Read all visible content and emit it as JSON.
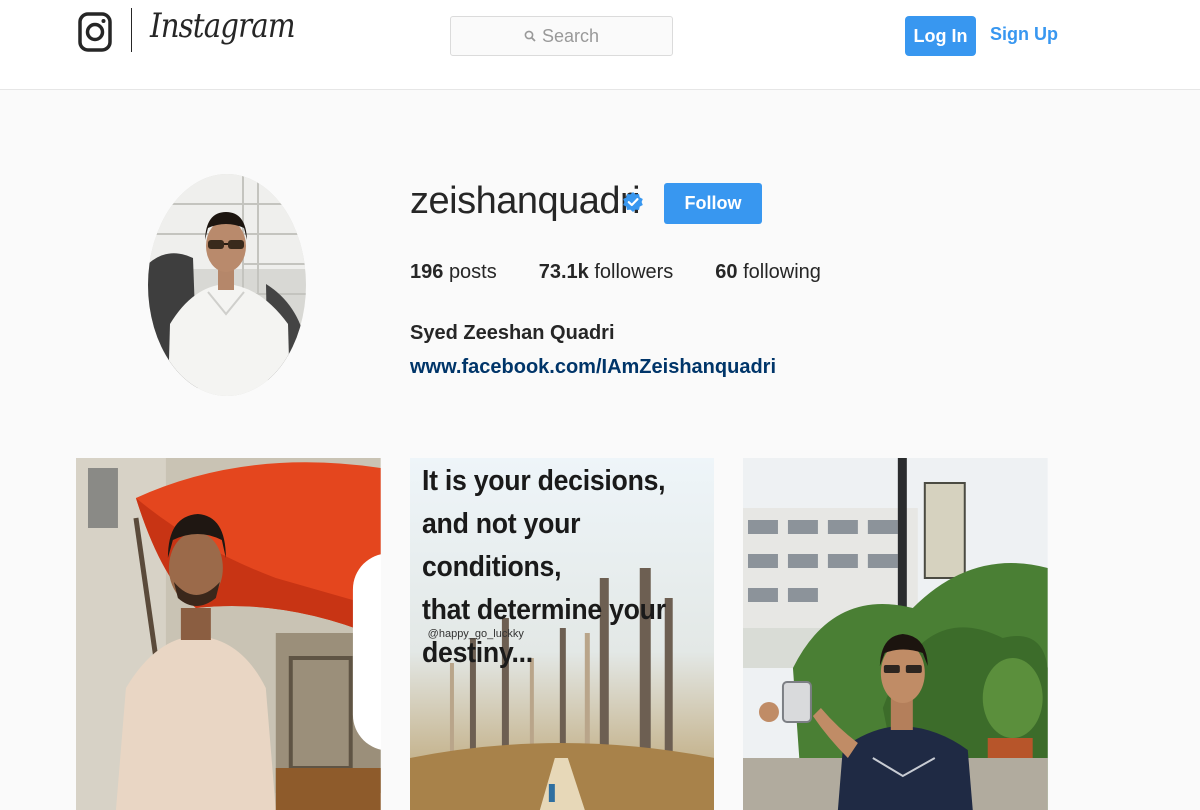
{
  "header": {
    "logo_text": "Instagram",
    "search_placeholder": "Search",
    "login_label": "Log In",
    "signup_label": "Sign Up",
    "accent": "#3897f0"
  },
  "profile": {
    "username": "zeishanquadri",
    "verified": true,
    "follow_label": "Follow",
    "posts_count": "196",
    "posts_label": "posts",
    "followers_count": "73.1k",
    "followers_label": "followers",
    "following_count": "60",
    "following_label": "following",
    "full_name": "Syed Zeeshan Quadri",
    "website": "www.facebook.com/IAmZeishanquadri"
  },
  "posts": [
    {
      "kind": "photo",
      "icon": "video-badge-icon"
    },
    {
      "kind": "quote",
      "lines": [
        "It is your decisions,",
        "and not your conditions,",
        "that determine your",
        "destiny..."
      ],
      "handle": "@happy_go_luckky"
    },
    {
      "kind": "photo"
    }
  ]
}
